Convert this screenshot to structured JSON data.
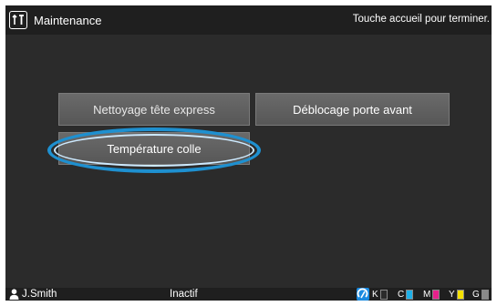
{
  "header": {
    "title": "Maintenance",
    "hint": "Touche accueil pour terminer."
  },
  "buttons": {
    "cleaning": "Nettoyage tête express",
    "front_door": "Déblocage porte avant",
    "glue_temp": "Température colle"
  },
  "status": {
    "user": "J.Smith",
    "state": "Inactif",
    "inks": [
      {
        "label": "K",
        "color": "#2b2b2b"
      },
      {
        "label": "C",
        "color": "#1eb0e8"
      },
      {
        "label": "M",
        "color": "#e8218c"
      },
      {
        "label": "Y",
        "color": "#f5e100"
      },
      {
        "label": "G",
        "color": "#8a8a8a"
      }
    ]
  },
  "accent_color": "#1e90d0"
}
